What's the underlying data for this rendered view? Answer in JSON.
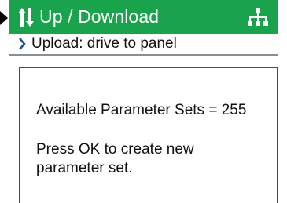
{
  "header": {
    "title": "Up / Download",
    "left_icon": "up-down-arrows-icon",
    "right_icon": "network-icon",
    "color": "#1aa34d"
  },
  "subheader": {
    "icon": "chevron-right-icon",
    "text": "Upload: drive to panel"
  },
  "content": {
    "available": "Available Parameter Sets = 255",
    "instruction_line1": "Press OK to create new",
    "instruction_line2": "parameter set."
  }
}
